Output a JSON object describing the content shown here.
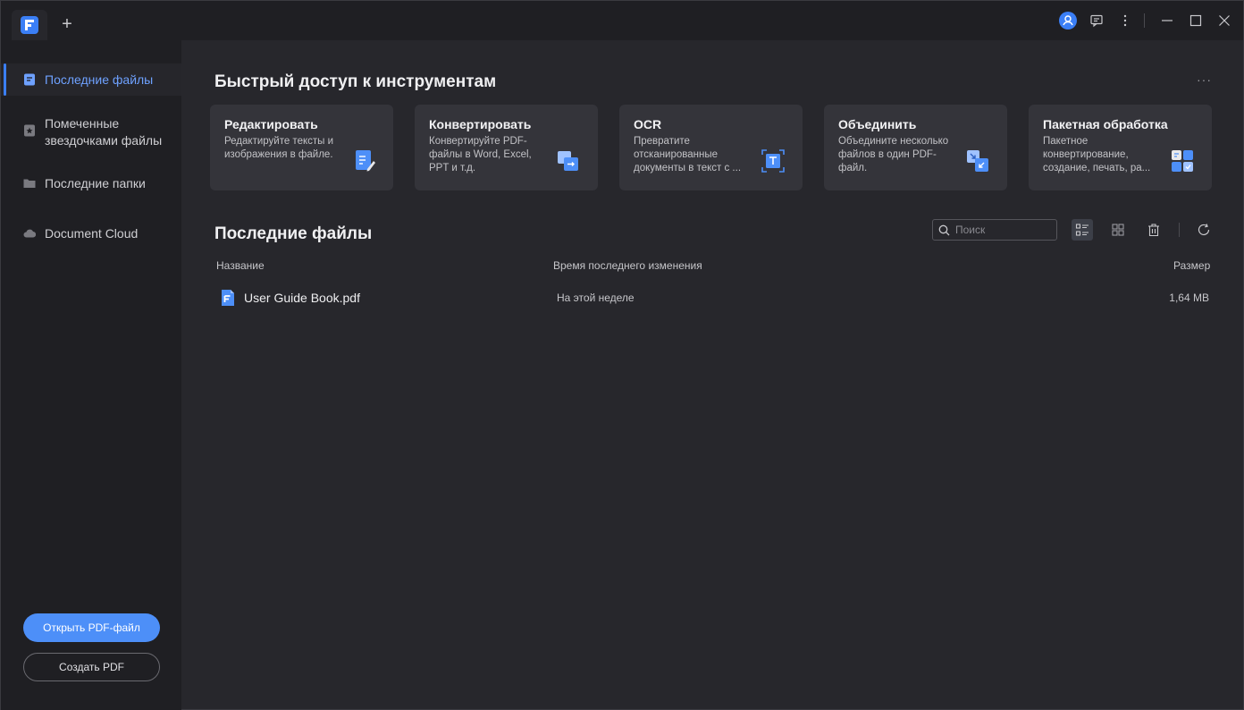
{
  "titlebar": {
    "new_tab": "+",
    "icons": [
      "user-avatar-icon",
      "feedback-icon",
      "more-vertical-icon",
      "minimize-icon",
      "maximize-icon",
      "close-icon"
    ]
  },
  "sidebar": {
    "items": [
      {
        "label": "Последние файлы",
        "icon": "recent-file-icon",
        "active": true
      },
      {
        "label": "Помеченные звездочками файлы",
        "icon": "starred-icon",
        "active": false
      },
      {
        "label": "Последние папки",
        "icon": "folder-icon",
        "active": false
      },
      {
        "label": "Document Cloud",
        "icon": "cloud-icon",
        "active": false
      }
    ],
    "open_button": "Открыть PDF-файл",
    "create_button": "Создать PDF"
  },
  "quick_access": {
    "title": "Быстрый доступ к инструментам",
    "more": "···",
    "cards": [
      {
        "title": "Редактировать",
        "desc": "Редактируйте тексты и изображения в файле.",
        "icon": "edit-document-icon"
      },
      {
        "title": "Конвертировать",
        "desc": "Конвертируйте PDF-файлы в Word, Excel, PPT и т.д.",
        "icon": "convert-icon"
      },
      {
        "title": "OCR",
        "desc": "Превратите отсканированные документы в текст с ...",
        "icon": "ocr-icon"
      },
      {
        "title": "Объединить",
        "desc": "Объедините несколько файлов в один PDF-файл.",
        "icon": "combine-icon"
      },
      {
        "title": "Пакетная обработка",
        "desc": "Пакетное конвертирование, создание, печать, ра...",
        "icon": "batch-icon"
      }
    ]
  },
  "recent": {
    "title": "Последние файлы",
    "search_placeholder": "Поиск",
    "columns": {
      "name": "Название",
      "modified": "Время последнего изменения",
      "size": "Размер"
    },
    "files": [
      {
        "name": "User Guide Book.pdf",
        "modified": "На этой неделе",
        "size": "1,64 MB"
      }
    ]
  },
  "colors": {
    "accent": "#3b7ff6",
    "background": "#27272c",
    "sidebar": "#1f1f23",
    "card": "#34343a"
  }
}
